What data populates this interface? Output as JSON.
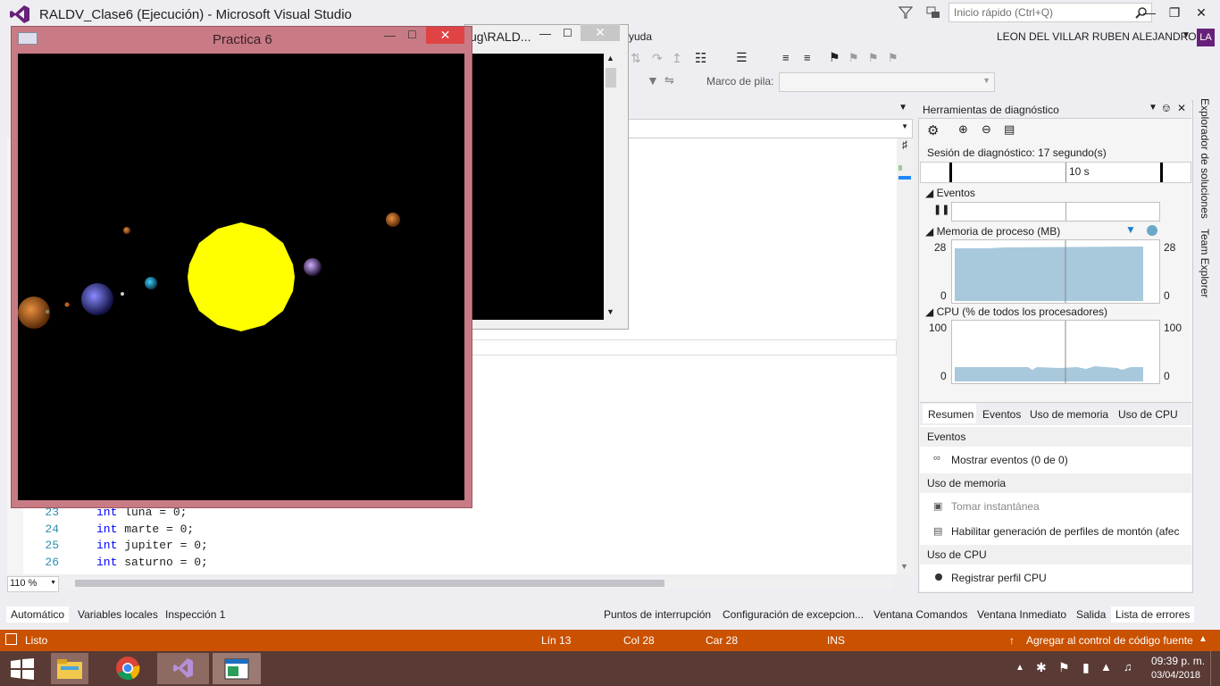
{
  "vs": {
    "title": "RALDV_Clase6 (Ejecución) - Microsoft Visual Studio",
    "quick_launch_placeholder": "Inicio rápido (Ctrl+Q)",
    "user": "LEON DEL VILLAR RUBEN ALEJANDRO",
    "avatar": "LA",
    "menu_partial": "yuda",
    "stack_frame_label": "Marco de pila:",
    "zoom": "110 %"
  },
  "code_lines": [
    {
      "num": "23",
      "kw": "int",
      "rest": " luna = 0;"
    },
    {
      "num": "24",
      "kw": "int",
      "rest": " marte = 0;"
    },
    {
      "num": "25",
      "kw": "int",
      "rest": " jupiter = 0;"
    },
    {
      "num": "26",
      "kw": "int",
      "rest": " saturno = 0;"
    }
  ],
  "console_window": {
    "title": "ug\\RALD..."
  },
  "gl_window": {
    "title": "Practica 6",
    "background": "#000000",
    "sun_color": "#ffff00"
  },
  "diagnostics": {
    "title": "Herramientas de diagnóstico",
    "session": "Sesión de diagnóstico: 17 segundo(s)",
    "timeline_label": "10 s",
    "events_section": "Eventos",
    "memory_section": "Memoria de proceso (MB)",
    "memory_max": "28",
    "memory_min": "0",
    "memory_max_right": "28",
    "memory_min_right": "0",
    "cpu_section": "CPU (% de todos los procesadores)",
    "cpu_max": "100",
    "cpu_min": "0",
    "cpu_max_right": "100",
    "cpu_min_right": "0",
    "tabs": [
      "Resumen",
      "Eventos",
      "Uso de memoria",
      "Uso de CPU"
    ],
    "events_heading": "Eventos",
    "show_events": "Mostrar eventos (0 de 0)",
    "memory_heading": "Uso de memoria",
    "take_snapshot": "Tomar instantánea",
    "heap_profiling": "Habilitar generación de perfiles de montón (afec",
    "cpu_heading": "Uso de CPU",
    "record_cpu": "Registrar perfil CPU"
  },
  "side_tabs": [
    "Explorador de soluciones",
    "Team Explorer"
  ],
  "bottom_left_tabs": [
    "Automático",
    "Variables locales",
    "Inspección 1"
  ],
  "bottom_right_tabs": [
    "Puntos de interrupción",
    "Configuración de excepcion...",
    "Ventana Comandos",
    "Ventana Inmediato",
    "Salida",
    "Lista de errores"
  ],
  "status": {
    "ready": "Listo",
    "line": "Lín 13",
    "col": "Col 28",
    "car": "Car 28",
    "ins": "INS",
    "source_control": "Agregar al control de código fuente"
  },
  "taskbar": {
    "time": "09:39 p. m.",
    "date": "03/04/2018"
  },
  "colors": {
    "accent": "#68217a",
    "status_bar": "#ca5100",
    "graph_fill": "#a8c8dc"
  }
}
